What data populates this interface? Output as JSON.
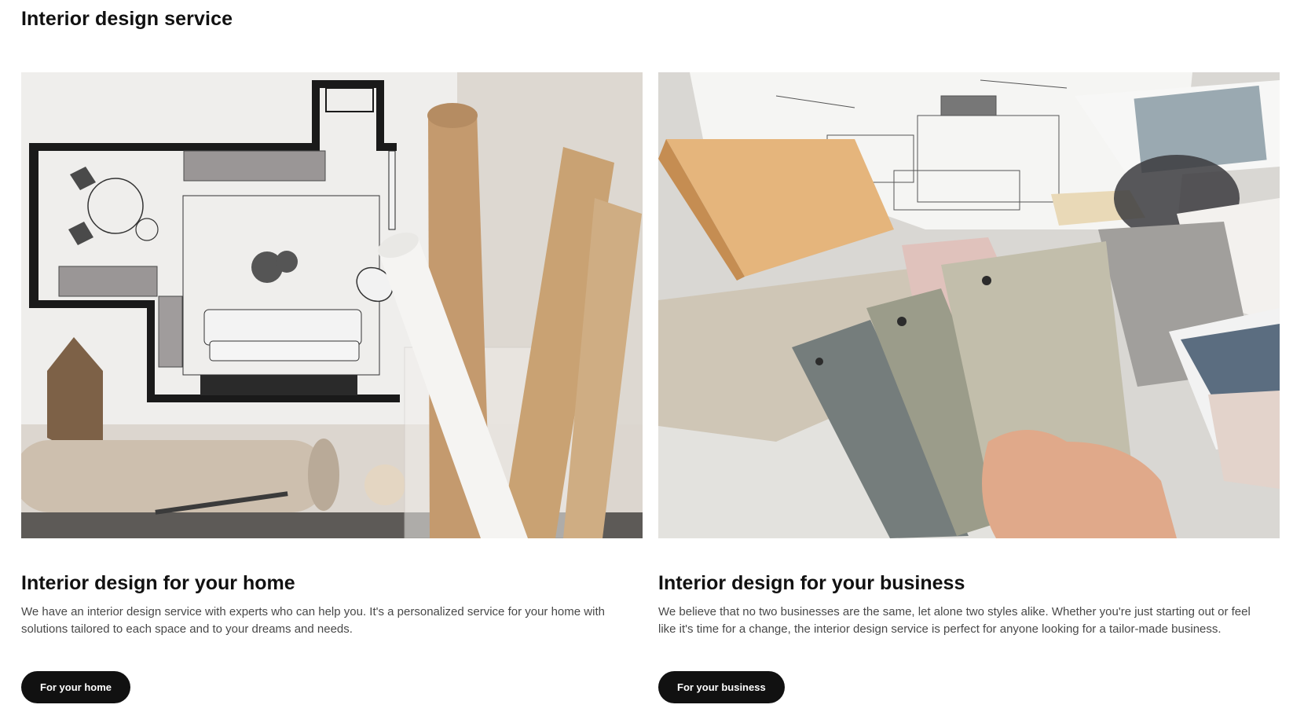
{
  "page": {
    "title": "Interior design service"
  },
  "cards": [
    {
      "image_alt": "Floor plan sketch with paper rolls in a glass jar",
      "title": "Interior design for your home",
      "description": "We have an interior design service with experts who can help you. It's a personalized service for your home with solutions tailored to each space and to your dreams and needs.",
      "button_label": "For your home"
    },
    {
      "image_alt": "Hand holding paint color swatches over floor plans and material samples",
      "title": "Interior design for your business",
      "description": "We believe that no two businesses are the same, let alone two styles alike. Whether you're just starting out or feel like it's time for a change, the interior design service is perfect for anyone looking for a tailor-made business.",
      "button_label": "For your business"
    }
  ],
  "colors": {
    "text": "#111111",
    "body_text": "#484848",
    "button_bg": "#111111",
    "button_text": "#ffffff"
  }
}
